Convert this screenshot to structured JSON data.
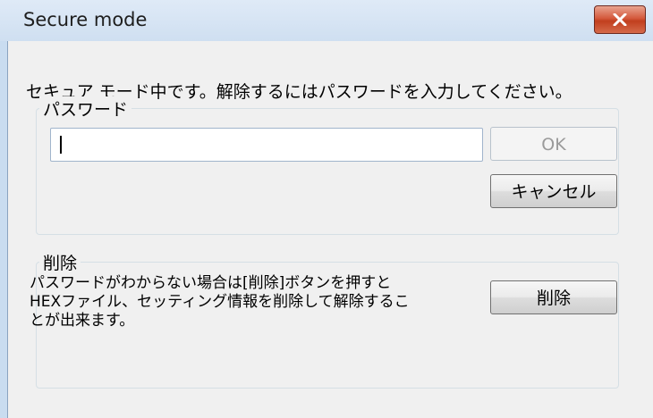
{
  "window": {
    "title": "Secure mode",
    "close_icon": "close-x-icon"
  },
  "message": "セキュア モード中です。解除するにはパスワードを入力してください。",
  "password_group": {
    "label": "パスワード",
    "input_value": "",
    "ok_label": "OK",
    "cancel_label": "キャンセル"
  },
  "delete_group": {
    "label": "削除",
    "description_lines": [
      "パスワードがわからない場合は[削除]ボタンを押すと",
      "HEXファイル、セッティング情報を削除して解除するこ",
      "とが出来ます。"
    ],
    "delete_label": "削除"
  },
  "colors": {
    "titlebar": "#cfdff1",
    "close_button": "#c94a2b",
    "client_bg": "#f0f0f0"
  }
}
